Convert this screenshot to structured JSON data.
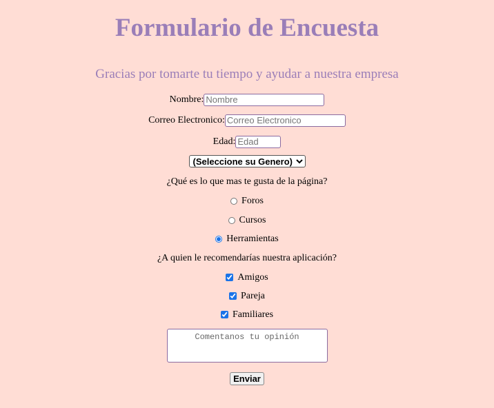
{
  "title": "Formulario de Encuesta",
  "subtitle": "Gracias por tomarte tu tiempo y ayudar a nuestra empresa",
  "fields": {
    "nombre": {
      "label": "Nombre:",
      "placeholder": "Nombre"
    },
    "correo": {
      "label": "Correo Electronico:",
      "placeholder": "Correo Electronico"
    },
    "edad": {
      "label": "Edad:",
      "placeholder": "Edad"
    }
  },
  "genero_select": {
    "selected": "(Seleccione su Genero)"
  },
  "question1": {
    "text": "¿Qué es lo que mas te gusta de la página?",
    "options": [
      {
        "label": "Foros",
        "checked": false
      },
      {
        "label": "Cursos",
        "checked": false
      },
      {
        "label": "Herramientas",
        "checked": true
      }
    ]
  },
  "question2": {
    "text": "¿A quien le recomendarías nuestra aplicación?",
    "options": [
      {
        "label": "Amigos",
        "checked": true
      },
      {
        "label": "Pareja",
        "checked": true
      },
      {
        "label": "Familiares",
        "checked": true
      }
    ]
  },
  "comment": {
    "placeholder": "Comentanos tu opinión"
  },
  "submit_label": "Enviar",
  "colors": {
    "background": "#ffddd5",
    "heading": "#9a7eb8",
    "accent": "#1a73e8"
  }
}
